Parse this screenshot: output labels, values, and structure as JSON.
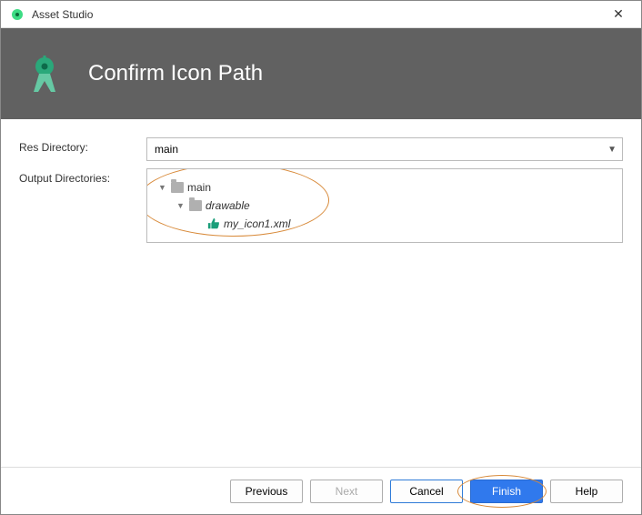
{
  "window": {
    "title": "Asset Studio"
  },
  "header": {
    "title": "Confirm Icon Path"
  },
  "form": {
    "res_dir_label": "Res Directory:",
    "res_dir_value": "main",
    "output_dirs_label": "Output Directories:"
  },
  "tree": {
    "root": {
      "label": "main"
    },
    "child": {
      "label": "drawable"
    },
    "leaf": {
      "label": "my_icon1.xml"
    }
  },
  "buttons": {
    "previous": "Previous",
    "next": "Next",
    "cancel": "Cancel",
    "finish": "Finish",
    "help": "Help"
  }
}
